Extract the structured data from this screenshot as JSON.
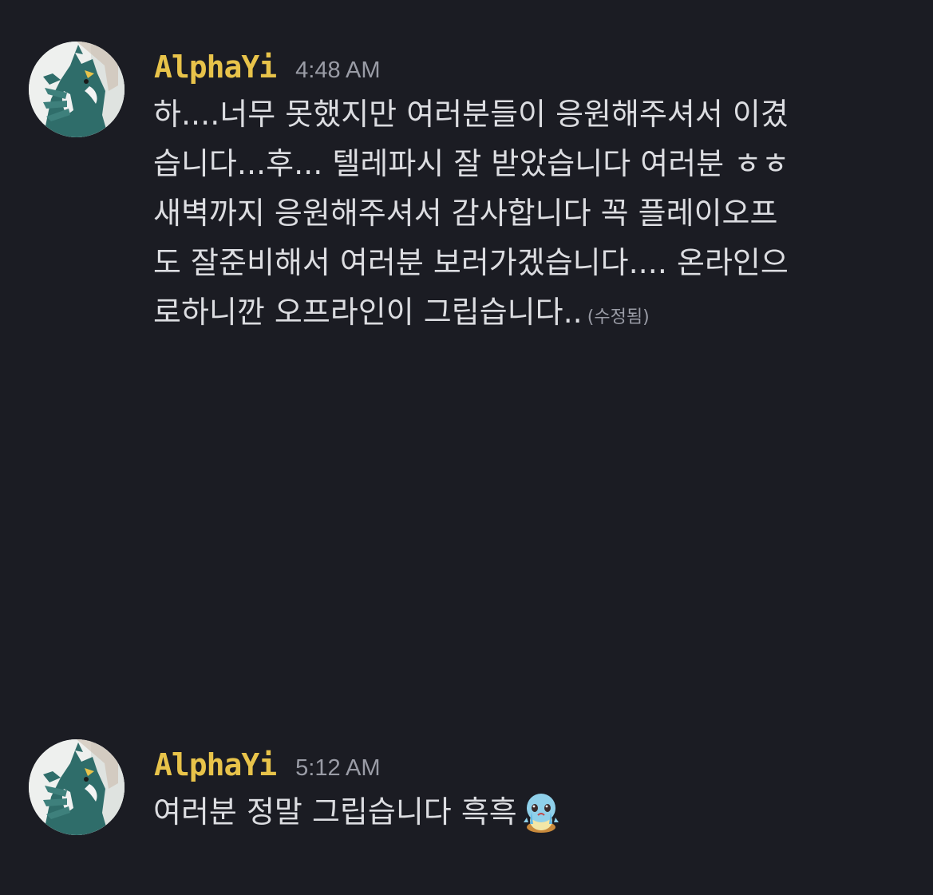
{
  "messages": [
    {
      "username": "AlphaYi",
      "timestamp": "4:48 AM",
      "lines": [
        "하....너무 못했지만 여러분들이 응원해주셔서 이겼",
        "습니다...후... 텔레파시 잘 받았습니다 여러분 ㅎㅎ",
        "새벽까지 응원해주셔서 감사합니다 꼭 플레이오프",
        "도 잘준비해서 여러분 보러가겠습니다.... 온라인으",
        "로하니깐 오프라인이 그립습니다.."
      ],
      "edited_label": "(수정됨)"
    },
    {
      "username": "AlphaYi",
      "timestamp": "5:12 AM",
      "text": "여러분 정말 그립습니다 흑흑",
      "emoji": "crying-squirtle-emoji"
    }
  ],
  "colors": {
    "background": "#1b1c23",
    "username": "#e8c34a",
    "text": "#dcdde1",
    "muted": "#9a9ca6"
  }
}
